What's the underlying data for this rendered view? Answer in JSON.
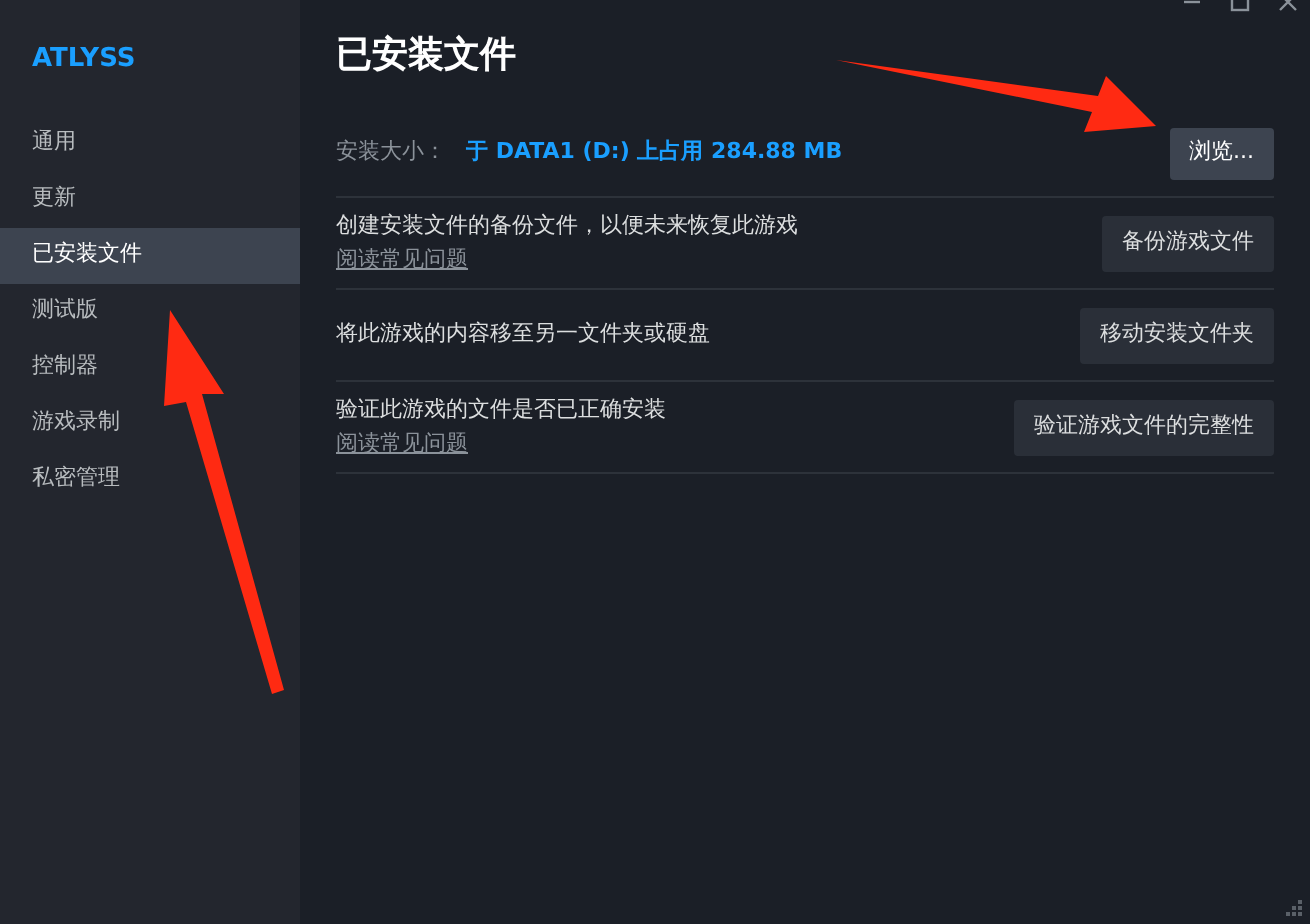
{
  "sidebar": {
    "title": "ATLYSS",
    "items": [
      {
        "label": "通用",
        "selected": false
      },
      {
        "label": "更新",
        "selected": false
      },
      {
        "label": "已安装文件",
        "selected": true
      },
      {
        "label": "测试版",
        "selected": false
      },
      {
        "label": "控制器",
        "selected": false
      },
      {
        "label": "游戏录制",
        "selected": false
      },
      {
        "label": "私密管理",
        "selected": false
      }
    ]
  },
  "page": {
    "title": "已安装文件",
    "size_label": "安装大小：",
    "size_value": "于 DATA1 (D:) 上占用 284.88 MB",
    "browse_button": "浏览...",
    "rows": [
      {
        "text": "创建安装文件的备份文件，以便未来恢复此游戏",
        "link": "阅读常见问题",
        "button": "备份游戏文件"
      },
      {
        "text": "将此游戏的内容移至另一文件夹或硬盘",
        "button": "移动安装文件夹"
      },
      {
        "text": "验证此游戏的文件是否已正确安装",
        "link": "阅读常见问题",
        "button": "验证游戏文件的完整性"
      }
    ]
  }
}
